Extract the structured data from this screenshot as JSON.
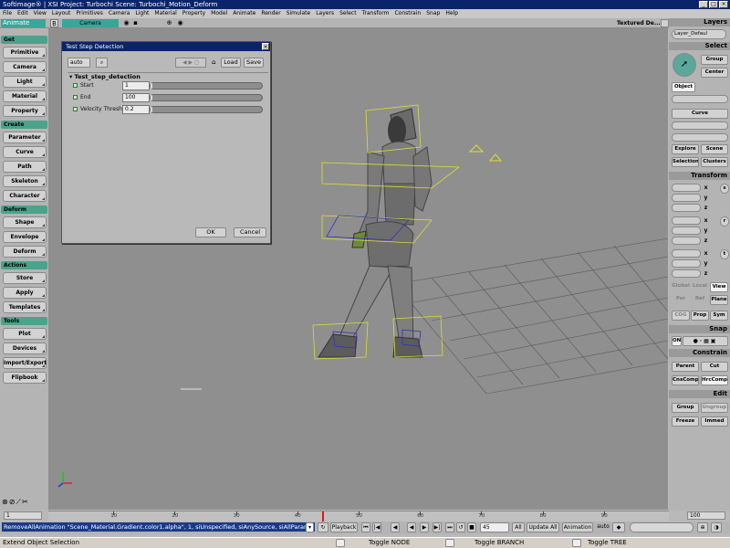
{
  "window": {
    "title": "Softimage® | XSI Project: Turbochi   Scene: Turbochi_Motion_Deform",
    "controls": [
      "_",
      "□",
      "×"
    ]
  },
  "menu": [
    "File",
    "Edit",
    "View",
    "Layout",
    "Primitives",
    "Camera",
    "Light",
    "Material",
    "Property",
    "Model",
    "Animate",
    "Render",
    "Simulate",
    "Layers",
    "Select",
    "Transform",
    "Constrain",
    "Snap",
    "Help"
  ],
  "mode_selector": "Animate",
  "viewport": {
    "camera_label": "Camera",
    "display_mode": "Textured De..."
  },
  "left_panel": {
    "sections": [
      {
        "title": "Get",
        "buttons": [
          "Primitive",
          "Camera",
          "Light",
          "Material",
          "Property"
        ]
      },
      {
        "title": "Create",
        "buttons": [
          "Parameter",
          "Curve",
          "Path",
          "Skeleton",
          "Character"
        ]
      },
      {
        "title": "Deform",
        "buttons": [
          "Shape",
          "Envelope",
          "Deform"
        ]
      },
      {
        "title": "Actions",
        "buttons": [
          "Store",
          "Apply",
          "Templates"
        ]
      },
      {
        "title": "Tools",
        "buttons": [
          "Plot",
          "Devices",
          "Import/Export",
          "Flipbook"
        ]
      }
    ]
  },
  "right_panel": {
    "layers_title": "Layers",
    "layer_value": "Layer_Defaul",
    "select_title": "Select",
    "group": "Group",
    "center": "Center",
    "object": "Object",
    "curve": "Curve",
    "explore": "Explore",
    "scene": "Scene",
    "selection": "Selection",
    "clusters": "Clusters",
    "transform_title": "Transform",
    "axes": [
      "x",
      "y",
      "z"
    ],
    "transform_icons": [
      "s",
      "r",
      "t"
    ],
    "global": "Global",
    "local": "Local",
    "view": "View",
    "par": "Par",
    "ref": "Ref",
    "plane": "Plane",
    "cog": "COG",
    "prop": "Prop",
    "sym": "Sym",
    "snap_title": "Snap",
    "snap_on": "ON",
    "constrain_title": "Constrain",
    "parent": "Parent",
    "cut": "Cut",
    "cnscomp": "CnsComp",
    "hrccomp": "HrcComp",
    "edit_title": "Edit",
    "group_btn": "Group",
    "ungroup": "Ungroup",
    "freeze": "Freeze",
    "immed": "Immed"
  },
  "dialog": {
    "title": "Test Step Detection",
    "auto": "auto",
    "nav_icons": "◀ ▶ ◻",
    "lock_icon": "🔒",
    "load": "Load",
    "save": "Save",
    "group": "Test_step_detection",
    "params": [
      {
        "label": "Start",
        "value": "1",
        "fraction": 0.0
      },
      {
        "label": "End",
        "value": "100",
        "fraction": 0.0
      },
      {
        "label": "Velocity Threshold",
        "value": "0.2",
        "fraction": 0.0
      }
    ],
    "ok": "OK",
    "cancel": "Cancel"
  },
  "timeline": {
    "ticks": [
      "10",
      "20",
      "30",
      "40",
      "50",
      "60",
      "70",
      "80",
      "90"
    ],
    "current_frame": "1",
    "end_frame": "100",
    "playhead_frame": 44
  },
  "playback": {
    "script_line": "RemoveAllAnimation \"Scene_Material.Gradient.color1.alpha\", 1, siUnspecified, siAnySource, siAllParam",
    "playback": "Playback",
    "frame": "45",
    "all": "All",
    "update_all": "Update All",
    "animation": "Animation",
    "auto": "auto"
  },
  "status": {
    "left": "Extend Object Selection",
    "n": "Toggle NODE",
    "m": "Toggle BRANCH",
    "r": "Toggle TREE"
  }
}
